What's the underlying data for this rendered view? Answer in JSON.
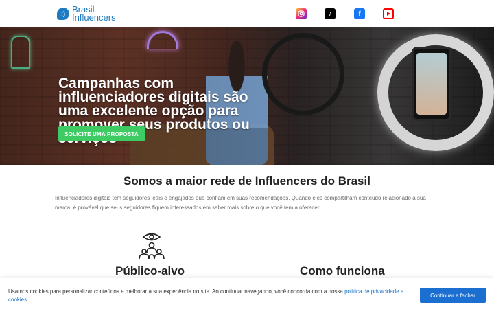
{
  "header": {
    "logo": {
      "line1": "Brasil",
      "line2": "Influencers",
      "mark": ":)"
    },
    "social": [
      {
        "name": "instagram",
        "icon": "instagram-icon"
      },
      {
        "name": "tiktok",
        "icon": "tiktok-icon",
        "glyph": "♪"
      },
      {
        "name": "facebook",
        "icon": "facebook-icon",
        "glyph": "f"
      },
      {
        "name": "youtube",
        "icon": "youtube-icon"
      }
    ]
  },
  "hero": {
    "headline": "Campanhas com influenciadores digitais são uma excelente opção para promover seus produtos ou serviços",
    "cta": "SOLICITE UMA PROPOSTA",
    "accent_color": "#3ecb63"
  },
  "about": {
    "title": "Somos a maior rede de Influencers do Brasil",
    "text": "Influenciadores digitais têm seguidores leais e engajados que confiam em suas recomendações. Quando eles compartilham conteúdo relacionado à sua marca, é provável que seus seguidores fiquem interessados em saber mais sobre o que você tem a oferecer."
  },
  "features": [
    {
      "title": "Público-alvo",
      "icon": "audience-eye-icon"
    },
    {
      "title": "Como funciona"
    }
  ],
  "cookie": {
    "text": "Usamos cookies para personalizar conteúdos e melhorar a sua experiência no site. Ao continuar navegando, você concorda com a nossa ",
    "link": "política de privacidade e cookies",
    "end": ".",
    "button": "Continuar e fechar",
    "button_color": "#1a6fd1"
  }
}
